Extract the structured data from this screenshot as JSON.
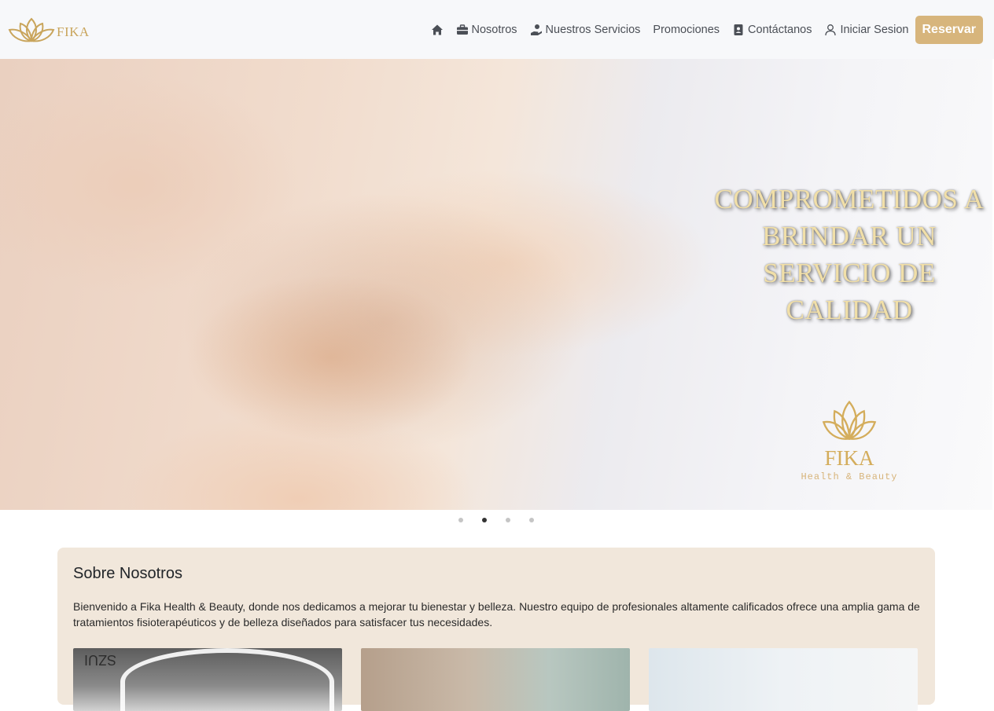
{
  "brand": {
    "name": "FIKA",
    "color": "#c9a55c"
  },
  "nav": {
    "home_icon": "home-icon",
    "items": [
      {
        "label": "Nosotros",
        "icon": "briefcase-icon"
      },
      {
        "label": "Nuestros Servicios",
        "icon": "hand-care-icon"
      },
      {
        "label": "Promociones",
        "icon": ""
      },
      {
        "label": "Contáctanos",
        "icon": "contact-book-icon"
      },
      {
        "label": "Iniciar Sesion",
        "icon": "user-icon"
      }
    ],
    "cta_label": "Reservar",
    "cta_color": "#d7b57c"
  },
  "hero": {
    "title": "COMPROMETIDOS A BRINDAR UN SERVICIO DE CALIDAD",
    "logo_name": "FIKA",
    "logo_tagline": "Health & Beauty",
    "slide_count": 4,
    "active_slide": 2
  },
  "about": {
    "title": "Sobre Nosotros",
    "text": "Bienvenido a Fika Health & Beauty, donde nos dedicamos a mejorar tu bienestar y belleza. Nuestro equipo de profesionales altamente calificados ofrece una amplia gama de tratamientos fisioterapéuticos y de belleza diseñados para satisfacer tus necesidades.",
    "background": "#f1e7db"
  }
}
